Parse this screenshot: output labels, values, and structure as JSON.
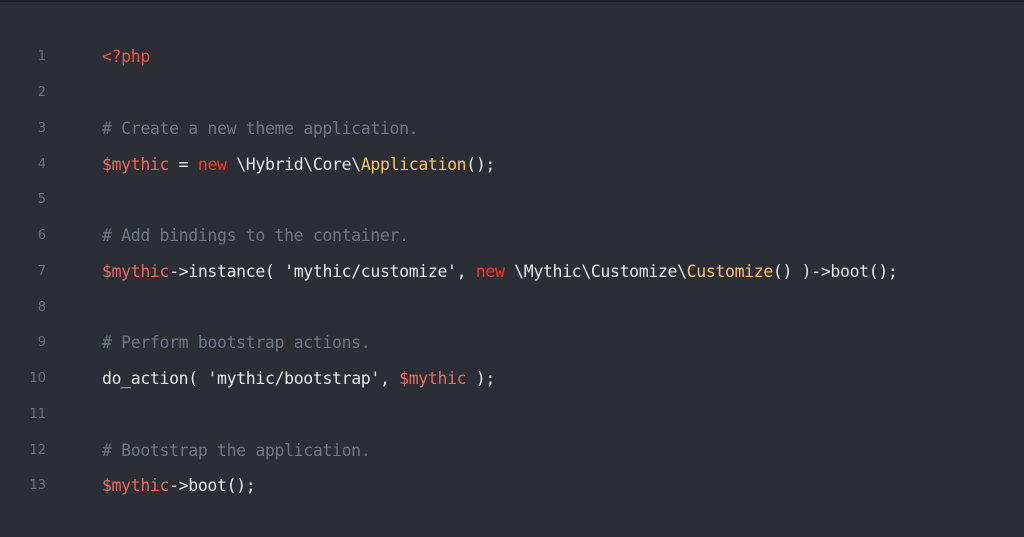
{
  "colors": {
    "background": "#2b2e35",
    "line_number": "#6a7080",
    "plain": "#e6e6e6",
    "comment": "#6f7886",
    "variable": "#ec6a5f",
    "keyword": "#f03b2a",
    "class_name": "#f5c56b",
    "php_tag": "#e8574a"
  },
  "lines": [
    {
      "number": "1",
      "tokens": [
        {
          "type": "tag",
          "text": "<?php"
        }
      ]
    },
    {
      "number": "2",
      "tokens": []
    },
    {
      "number": "3",
      "tokens": [
        {
          "type": "comment",
          "text": "# Create a new theme application."
        }
      ]
    },
    {
      "number": "4",
      "tokens": [
        {
          "type": "var",
          "text": "$mythic"
        },
        {
          "type": "plain",
          "text": " = "
        },
        {
          "type": "kw",
          "text": "new"
        },
        {
          "type": "plain",
          "text": " \\Hybrid\\Core\\"
        },
        {
          "type": "class",
          "text": "Application"
        },
        {
          "type": "plain",
          "text": "();"
        }
      ]
    },
    {
      "number": "5",
      "tokens": []
    },
    {
      "number": "6",
      "tokens": [
        {
          "type": "comment",
          "text": "# Add bindings to the container."
        }
      ]
    },
    {
      "number": "7",
      "tokens": [
        {
          "type": "var",
          "text": "$mythic"
        },
        {
          "type": "plain",
          "text": "->instance( "
        },
        {
          "type": "str",
          "text": "'mythic/customize'"
        },
        {
          "type": "plain",
          "text": ", "
        },
        {
          "type": "kw",
          "text": "new"
        },
        {
          "type": "plain",
          "text": " \\Mythic\\Customize\\"
        },
        {
          "type": "class",
          "text": "Customize"
        },
        {
          "type": "plain",
          "text": "() )->boot();"
        }
      ]
    },
    {
      "number": "8",
      "tokens": []
    },
    {
      "number": "9",
      "tokens": [
        {
          "type": "comment",
          "text": "# Perform bootstrap actions."
        }
      ]
    },
    {
      "number": "10",
      "tokens": [
        {
          "type": "plain",
          "text": "do_action( "
        },
        {
          "type": "str",
          "text": "'mythic/bootstrap'"
        },
        {
          "type": "plain",
          "text": ", "
        },
        {
          "type": "var",
          "text": "$mythic"
        },
        {
          "type": "plain",
          "text": " );"
        }
      ]
    },
    {
      "number": "11",
      "tokens": []
    },
    {
      "number": "12",
      "tokens": [
        {
          "type": "comment",
          "text": "# Bootstrap the application."
        }
      ]
    },
    {
      "number": "13",
      "tokens": [
        {
          "type": "var",
          "text": "$mythic"
        },
        {
          "type": "plain",
          "text": "->boot();"
        }
      ]
    }
  ]
}
